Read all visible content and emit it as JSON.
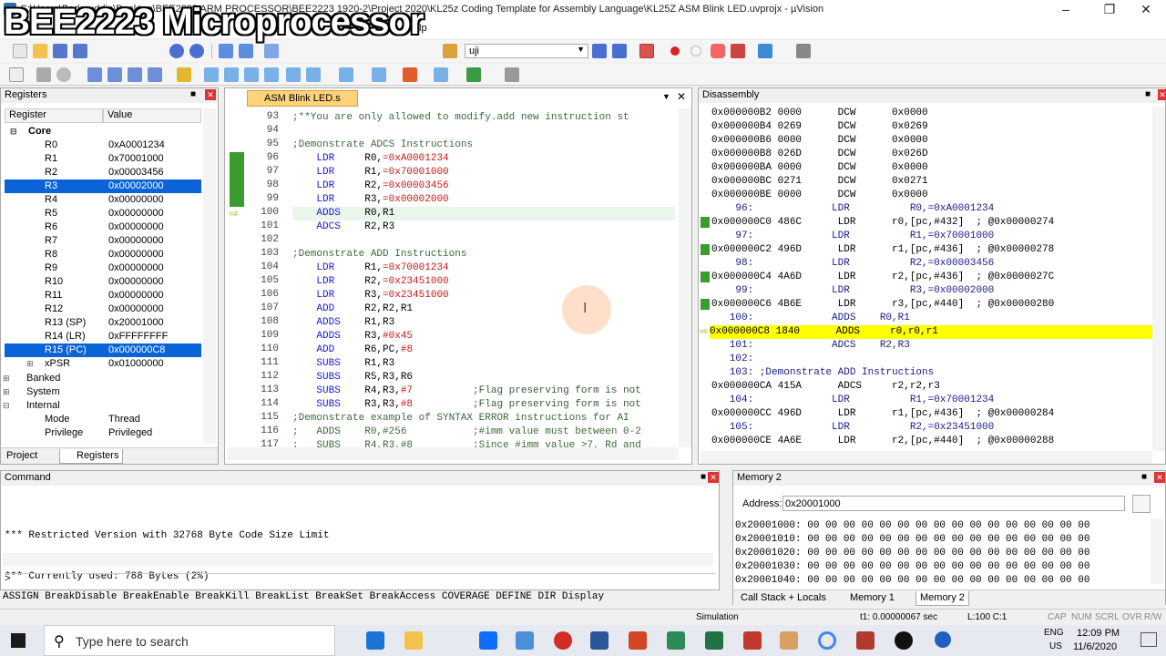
{
  "window": {
    "title": "C:\\Users\\Badaruddin\\Desktop\\BEE2223 ARM PROCESSOR\\BEE2223 1920-2\\Project 2020\\KL25z Coding Template for Assembly Language\\KL25Z ASM Blink LED.uvprojx - µVision",
    "overlay": "BEE2223 Microprocessor"
  },
  "menu": {
    "items": [
      "File",
      "Edit",
      "View",
      "Project",
      "Flash",
      "Debug",
      "Peripherals",
      "Tools",
      "SVCS",
      "Window",
      "Help"
    ],
    "help": "Help",
    "toolbar_target": "uji"
  },
  "registers": {
    "title": "Registers",
    "col_register": "Register",
    "col_value": "Value",
    "core_label": "Core",
    "rows": [
      {
        "name": "R0",
        "value": "0xA0001234"
      },
      {
        "name": "R1",
        "value": "0x70001000"
      },
      {
        "name": "R2",
        "value": "0x00003456"
      },
      {
        "name": "R3",
        "value": "0x00002000"
      },
      {
        "name": "R4",
        "value": "0x00000000"
      },
      {
        "name": "R5",
        "value": "0x00000000"
      },
      {
        "name": "R6",
        "value": "0x00000000"
      },
      {
        "name": "R7",
        "value": "0x00000000"
      },
      {
        "name": "R8",
        "value": "0x00000000"
      },
      {
        "name": "R9",
        "value": "0x00000000"
      },
      {
        "name": "R10",
        "value": "0x00000000"
      },
      {
        "name": "R11",
        "value": "0x00000000"
      },
      {
        "name": "R12",
        "value": "0x00000000"
      },
      {
        "name": "R13 (SP)",
        "value": "0x20001000"
      },
      {
        "name": "R14 (LR)",
        "value": "0xFFFFFFFF"
      },
      {
        "name": "R15 (PC)",
        "value": "0x000000C8"
      },
      {
        "name": "xPSR",
        "value": "0x01000000"
      }
    ],
    "banked": "Banked",
    "system": "System",
    "internal": "Internal",
    "mode_label": "Mode",
    "mode_value": "Thread",
    "privilege_label": "Privilege",
    "privilege_value": "Privileged",
    "tab_project": "Project",
    "tab_registers": "Registers"
  },
  "editor": {
    "tab": "ASM Blink LED.s",
    "lines": [
      {
        "n": "93",
        "t": ";**You are only allowed to modify.add new instruction st"
      },
      {
        "n": "94",
        "t": ""
      },
      {
        "n": "95",
        "t": ";Demonstrate ADCS Instructions"
      },
      {
        "n": "96",
        "t": "    LDR     R0,=0xA0001234"
      },
      {
        "n": "97",
        "t": "    LDR     R1,=0x70001000"
      },
      {
        "n": "98",
        "t": "    LDR     R2,=0x00003456"
      },
      {
        "n": "99",
        "t": "    LDR     R3,=0x00002000"
      },
      {
        "n": "100",
        "t": "    ADDS    R0,R1"
      },
      {
        "n": "101",
        "t": "    ADCS    R2,R3"
      },
      {
        "n": "102",
        "t": ""
      },
      {
        "n": "103",
        "t": ";Demonstrate ADD Instructions"
      },
      {
        "n": "104",
        "t": "    LDR     R1,=0x70001234"
      },
      {
        "n": "105",
        "t": "    LDR     R2,=0x23451000"
      },
      {
        "n": "106",
        "t": "    LDR     R3,=0x23451000"
      },
      {
        "n": "107",
        "t": "    ADD     R2,R2,R1"
      },
      {
        "n": "108",
        "t": "    ADDS    R1,R3"
      },
      {
        "n": "109",
        "t": "    ADDS    R3,#0x45"
      },
      {
        "n": "110",
        "t": "    ADD     R6,PC,#8"
      },
      {
        "n": "111",
        "t": "    SUBS    R1,R3"
      },
      {
        "n": "112",
        "t": "    SUBS    R5,R3,R6"
      },
      {
        "n": "113",
        "t": "    SUBS    R4,R3,#7          ;Flag preserving form is not"
      },
      {
        "n": "114",
        "t": "    SUBS    R3,R3,#8          ;Flag preserving form is not"
      },
      {
        "n": "115",
        "t": ";Demonstrate example of SYNTAX ERROR instructions for AI"
      },
      {
        "n": "116",
        "t": ";   ADDS    R0,#256           ;#imm value must between 0-2"
      },
      {
        "n": "117",
        "t": ";   SUBS    R4,R3,#8          ;Since #imm value >7, Rd and"
      }
    ]
  },
  "disassembly": {
    "title": "Disassembly",
    "lines": [
      {
        "t": "0x000000B2 0000      DCW      0x0000",
        "k": "plain"
      },
      {
        "t": "0x000000B4 0269      DCW      0x0269",
        "k": "plain"
      },
      {
        "t": "0x000000B6 0000      DCW      0x0000",
        "k": "plain"
      },
      {
        "t": "0x000000B8 026D      DCW      0x026D",
        "k": "plain"
      },
      {
        "t": "0x000000BA 0000      DCW      0x0000",
        "k": "plain"
      },
      {
        "t": "0x000000BC 0271      DCW      0x0271",
        "k": "plain"
      },
      {
        "t": "0x000000BE 0000      DCW      0x0000",
        "k": "plain"
      },
      {
        "t": "    96:             LDR          R0,=0xA0001234",
        "k": "src"
      },
      {
        "t": "0x000000C0 486C      LDR      r0,[pc,#432]  ; @0x00000274",
        "k": "mark"
      },
      {
        "t": "    97:             LDR          R1,=0x70001000",
        "k": "src"
      },
      {
        "t": "0x000000C2 496D      LDR      r1,[pc,#436]  ; @0x00000278",
        "k": "mark"
      },
      {
        "t": "    98:             LDR          R2,=0x00003456",
        "k": "src"
      },
      {
        "t": "0x000000C4 4A6D      LDR      r2,[pc,#436]  ; @0x0000027C",
        "k": "mark"
      },
      {
        "t": "    99:             LDR          R3,=0x00002000",
        "k": "src"
      },
      {
        "t": "0x000000C6 4B6E      LDR      r3,[pc,#440]  ; @0x00000280",
        "k": "mark"
      },
      {
        "t": "   100:             ADDS    R0,R1",
        "k": "src"
      },
      {
        "t": "0x000000C8 1840      ADDS     r0,r0,r1",
        "k": "cur"
      },
      {
        "t": "   101:             ADCS    R2,R3",
        "k": "src"
      },
      {
        "t": "   102:",
        "k": "src"
      },
      {
        "t": "   103: ;Demonstrate ADD Instructions",
        "k": "src"
      },
      {
        "t": "0x000000CA 415A      ADCS     r2,r2,r3",
        "k": "plain"
      },
      {
        "t": "   104:             LDR          R1,=0x70001234",
        "k": "src"
      },
      {
        "t": "0x000000CC 496D      LDR      r1,[pc,#436]  ; @0x00000284",
        "k": "plain"
      },
      {
        "t": "   105:             LDR          R2,=0x23451000",
        "k": "src"
      },
      {
        "t": "0x000000CE 4A6E      LDR      r2,[pc,#440]  ; @0x00000288",
        "k": "plain"
      }
    ]
  },
  "command": {
    "title": "Command",
    "output": [
      "*** Restricted Version with 32768 Byte Code Size Limit",
      "*** Currently used: 788 Bytes (2%)"
    ],
    "prompt": ">",
    "help": "ASSIGN BreakDisable BreakEnable BreakKill BreakList BreakSet BreakAccess COVERAGE DEFINE DIR Display"
  },
  "memory": {
    "title": "Memory 2",
    "address_label": "Address:",
    "address_value": "0x20001000",
    "rows": [
      "0x20001000: 00 00 00 00 00 00 00 00 00 00 00 00 00 00 00 00",
      "0x20001010: 00 00 00 00 00 00 00 00 00 00 00 00 00 00 00 00",
      "0x20001020: 00 00 00 00 00 00 00 00 00 00 00 00 00 00 00 00",
      "0x20001030: 00 00 00 00 00 00 00 00 00 00 00 00 00 00 00 00",
      "0x20001040: 00 00 00 00 00 00 00 00 00 00 00 00 00 00 00 00"
    ],
    "tabs": [
      "Call Stack + Locals",
      "Memory 1",
      "Memory 2"
    ]
  },
  "status": {
    "mode": "Simulation",
    "time": "t1: 0.00000067 sec",
    "pos": "L:100 C:1",
    "caps": "CAP",
    "num": "NUM",
    "scrl": "SCRL",
    "ovr": "OVR",
    "rw": "R/W"
  },
  "taskbar": {
    "search_placeholder": "Type here to search",
    "lang": "ENG",
    "region": "US",
    "time": "12:09 PM",
    "date": "11/6/2020"
  }
}
